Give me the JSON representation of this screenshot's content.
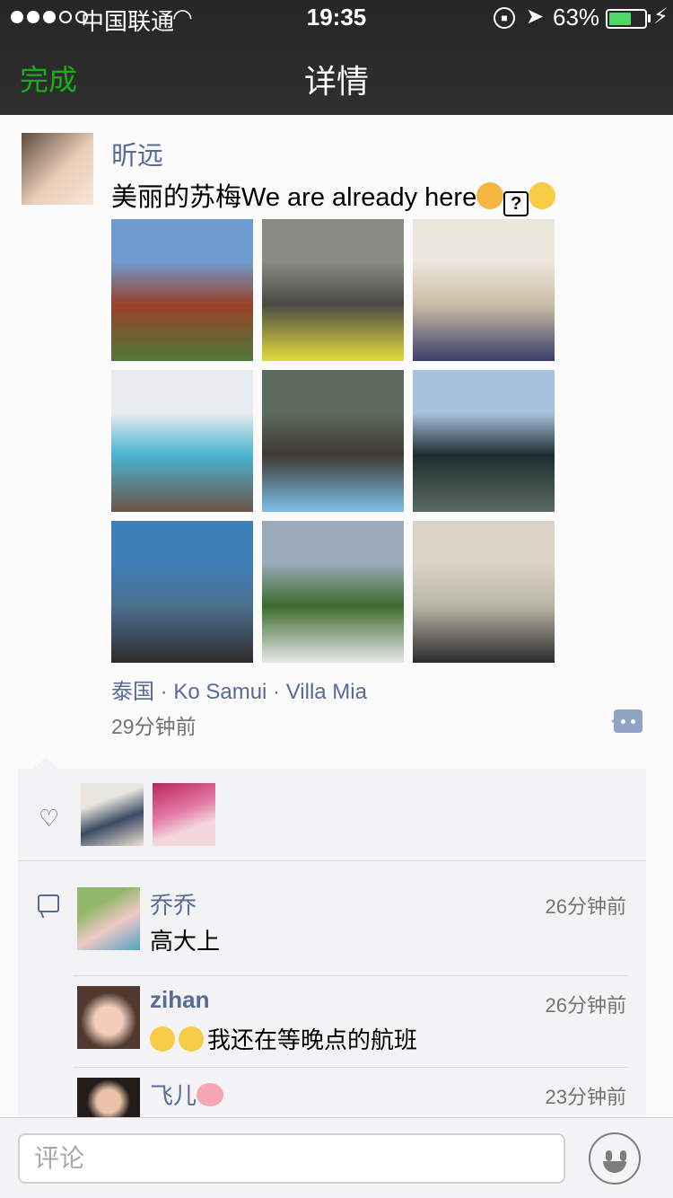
{
  "status_bar": {
    "carrier": "中国联通",
    "time": "19:35",
    "battery_percent": "63%",
    "battery_level": 0.63,
    "signal_dots_filled": 3,
    "signal_dots_total": 5,
    "icons": [
      "signal-dots-icon",
      "wifi-icon",
      "rotation-lock-icon",
      "location-arrow-icon",
      "battery-icon",
      "charging-bolt-icon"
    ]
  },
  "nav": {
    "done_label": "完成",
    "title": "详情"
  },
  "post": {
    "author": "昕远",
    "text": "美丽的苏梅We are already here",
    "text_emoji_icons": [
      "party-popper-icon",
      "question-box-icon",
      "clapping-hands-icon"
    ],
    "location": "泰国 · Ko Samui · Villa Mia",
    "time": "29分钟前",
    "photos": [
      {
        "name": "photo-resort-pavilion",
        "colors": [
          "#6f9ccf",
          "#9a3f2a",
          "#4f7a3a"
        ]
      },
      {
        "name": "photo-villa-entrance",
        "colors": [
          "#8b8b86",
          "#4a4a45",
          "#e2dd3d"
        ]
      },
      {
        "name": "photo-bedroom",
        "colors": [
          "#ece7dc",
          "#c9bda5",
          "#3b3e6a"
        ]
      },
      {
        "name": "photo-lobby-pool",
        "colors": [
          "#e8ecef",
          "#4ab3cf",
          "#6b5548"
        ]
      },
      {
        "name": "photo-courtyard-bathtub",
        "colors": [
          "#5d6b5e",
          "#3f3a33",
          "#7cc0e8"
        ]
      },
      {
        "name": "photo-reflecting-pool",
        "colors": [
          "#a6c2dc",
          "#1e2e2f",
          "#5e6b62"
        ]
      },
      {
        "name": "photo-beach-pod",
        "colors": [
          "#3f7fb8",
          "#4c6f8f",
          "#2f2b2b"
        ]
      },
      {
        "name": "photo-garden-beanbags",
        "colors": [
          "#9aaab9",
          "#3c6b2c",
          "#e9e9e9"
        ]
      },
      {
        "name": "photo-bathroom",
        "colors": [
          "#d9d4c6",
          "#b8b4a6",
          "#2b2b2b"
        ]
      }
    ]
  },
  "likes": {
    "icon": "heart-outline-icon",
    "count_avatars": 2
  },
  "comments": {
    "icon": "speech-bubble-icon",
    "items": [
      {
        "name": "乔乔",
        "text": "高大上",
        "time": "26分钟前"
      },
      {
        "name": "zihan",
        "text": "我还在等晚点的航班",
        "time": "26分钟前",
        "emoji_icons": [
          "crying-face-icon",
          "crying-face-icon"
        ]
      },
      {
        "name": "飞儿",
        "text": "",
        "time": "23分钟前",
        "name_emoji_icon": "pig-face-icon"
      }
    ]
  },
  "input_bar": {
    "placeholder": "评论",
    "emoji_button_icon": "smiley-face-icon"
  },
  "colors": {
    "nav_bg": "#2a2a2a",
    "accent_green": "#1aad19",
    "link_blue": "#576b95",
    "comment_box_bg": "#f3f3f5",
    "battery_green": "#4cd964"
  }
}
